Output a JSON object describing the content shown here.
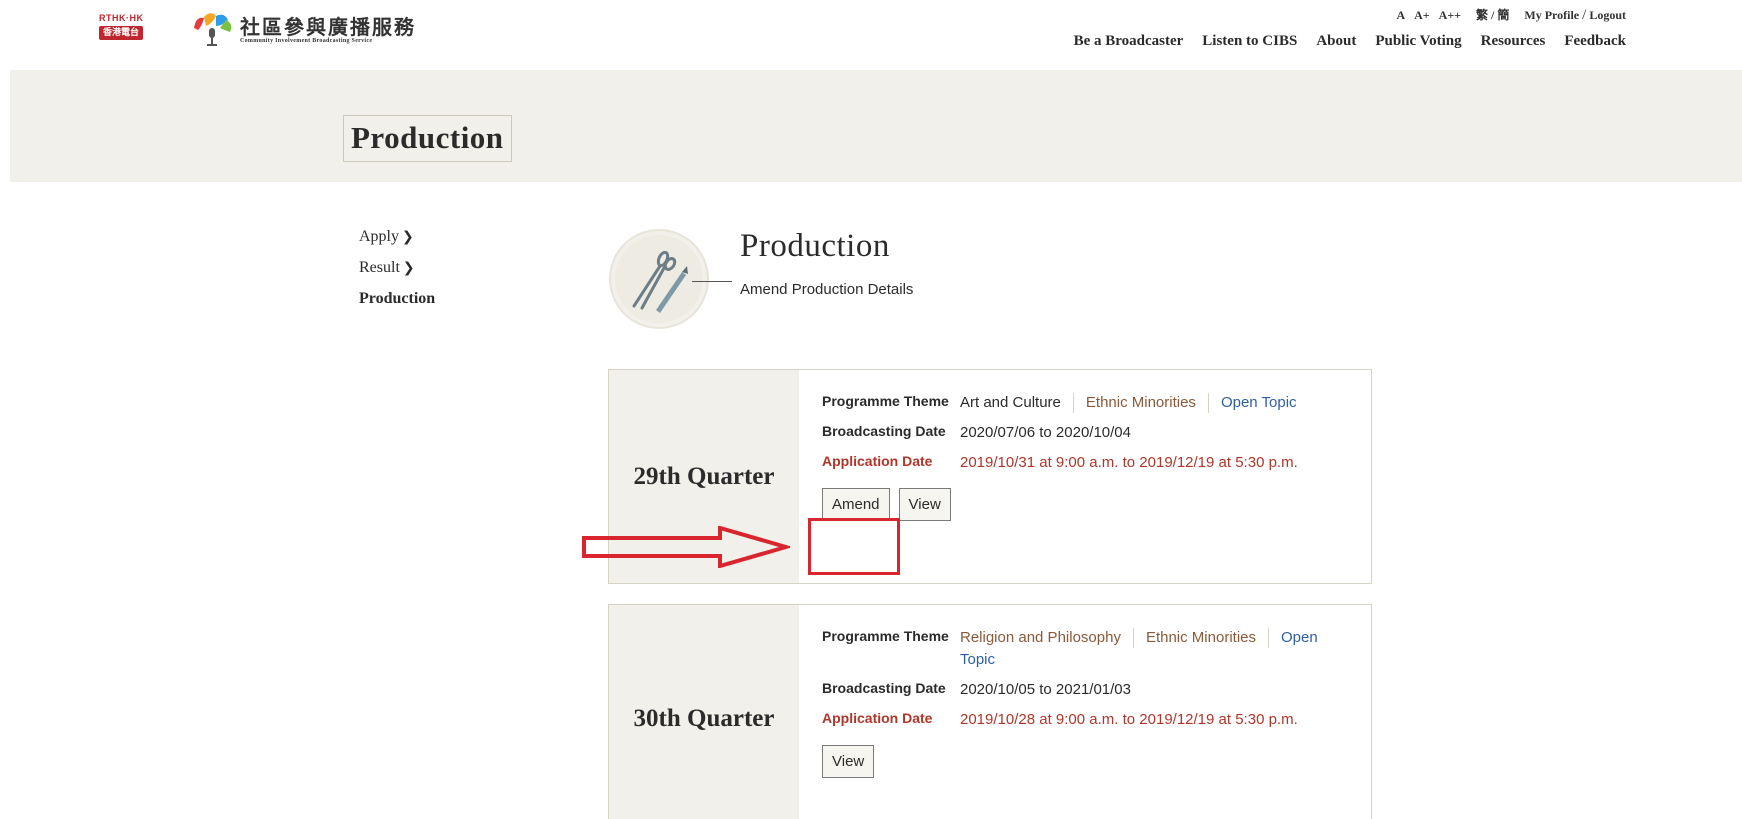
{
  "header": {
    "rthk_logo_top": "RTHK·HK",
    "rthk_logo_bottom": "香港電台",
    "cibs_logo_cn": "社區參與廣播服務",
    "cibs_logo_en": "Community Involvement Broadcasting Service",
    "font_sizes": [
      "A",
      "A+",
      "A++"
    ],
    "lang_trad": "繁",
    "lang_sep": "/",
    "lang_simp": "簡",
    "my_profile": "My Profile",
    "logout_sep": "/",
    "logout": "Logout",
    "nav": [
      "Be a Broadcaster",
      "Listen to CIBS",
      "About",
      "Public Voting",
      "Resources",
      "Feedback"
    ]
  },
  "banner": {
    "title": "Production"
  },
  "sidebar": {
    "items": [
      {
        "label": "Apply",
        "has_chevron": true
      },
      {
        "label": "Result",
        "has_chevron": true
      },
      {
        "label": "Production",
        "active": true
      }
    ]
  },
  "section": {
    "icon": "scissors-pen-icon",
    "title": "Production",
    "subtitle": "Amend Production Details"
  },
  "cards": [
    {
      "quarter": "29th Quarter",
      "theme_label": "Programme Theme",
      "themes": [
        "Art and Culture",
        "Ethnic Minorities",
        "Open Topic"
      ],
      "broadcast_label": "Broadcasting Date",
      "broadcast_value": "2020/07/06 to 2020/10/04",
      "application_label": "Application Date",
      "application_value": "2019/10/31 at 9:00 a.m. to 2019/12/19 at 5:30 p.m.",
      "amend_label": "Amend",
      "view_label": "View"
    },
    {
      "quarter": "30th Quarter",
      "theme_label": "Programme Theme",
      "themes": [
        "Religion and Philosophy",
        "Ethnic Minorities",
        "Open Topic"
      ],
      "broadcast_label": "Broadcasting Date",
      "broadcast_value": "2020/10/05 to 2021/01/03",
      "application_label": "Application Date",
      "application_value": "2019/10/28 at 9:00 a.m. to 2019/12/19 at 5:30 p.m.",
      "view_label": "View"
    }
  ],
  "colors": {
    "banner_bg": "#f2f0ea",
    "annotation_red": "#d9262e",
    "application_red": "#b0362a",
    "link_blue": "#2f5fa3",
    "theme_brown": "#8a5a3a"
  }
}
